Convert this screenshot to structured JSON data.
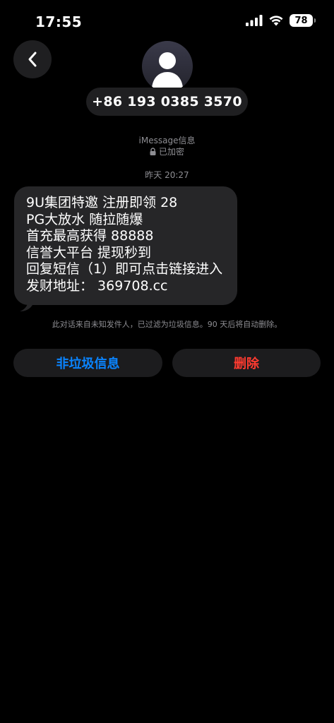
{
  "status_bar": {
    "time": "17:55",
    "battery": "78"
  },
  "contact": {
    "phone": "+86 193 0385 3570"
  },
  "conversation": {
    "service": "iMessage信息",
    "encrypted": "已加密",
    "timestamp": "昨天 20:27"
  },
  "message": {
    "lines": [
      "9U集团特邀 注册即领 28",
      "PG大放水 随拉随爆",
      "首充最高获得 88888",
      "信誉大平台 提现秒到",
      "回复短信（1）即可点击链接进入",
      "发财地址：  369708.cc"
    ]
  },
  "junk_notice": "此对话来自未知发件人，已过滤为垃圾信息。90 天后将自动删除。",
  "actions": {
    "not_junk": "非垃圾信息",
    "delete": "删除"
  },
  "colors": {
    "background": "#000000",
    "bubble": "#262628",
    "link_blue": "#0a84ff",
    "destructive_red": "#ff3b30",
    "secondary_text": "#8e8e93"
  }
}
